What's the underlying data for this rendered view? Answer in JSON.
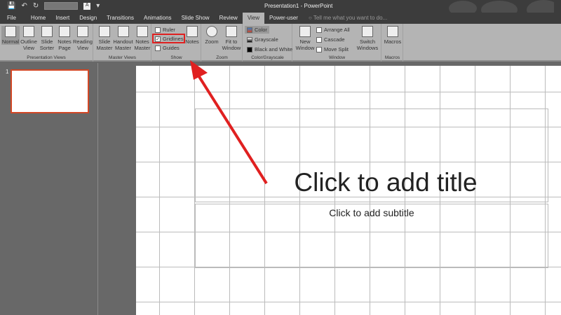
{
  "window": {
    "title": "Presentation1 - PowerPoint"
  },
  "tabs": [
    "File",
    "Home",
    "Insert",
    "Design",
    "Transitions",
    "Animations",
    "Slide Show",
    "Review",
    "View",
    "Power-user"
  ],
  "tell_me": "Tell me what you want to do...",
  "ribbon": {
    "presentation_views": {
      "label": "Presentation Views",
      "buttons": [
        "Normal",
        "Outline View",
        "Slide Sorter",
        "Notes Page",
        "Reading View"
      ]
    },
    "master_views": {
      "label": "Master Views",
      "buttons": [
        "Slide Master",
        "Handout Master",
        "Notes Master"
      ]
    },
    "show": {
      "label": "Show",
      "ruler": "Ruler",
      "gridlines": "Gridlines",
      "guides": "Guides",
      "notes": "Notes",
      "ruler_checked": false,
      "gridlines_checked": true,
      "guides_checked": false
    },
    "zoom": {
      "label": "Zoom",
      "zoom": "Zoom",
      "fit": "Fit to Window"
    },
    "color": {
      "label": "Color/Grayscale",
      "color": "Color",
      "grayscale": "Grayscale",
      "bw": "Black and White"
    },
    "window": {
      "label": "Window",
      "new_window": "New Window",
      "arrange_all": "Arrange All",
      "cascade": "Cascade",
      "move_split": "Move Split",
      "switch": "Switch Windows"
    },
    "macros": {
      "label": "Macros",
      "macros": "Macros"
    }
  },
  "thumbnail": {
    "number": "1"
  },
  "slide": {
    "title_placeholder": "Click to add title",
    "subtitle_placeholder": "Click to add subtitle"
  },
  "colors": {
    "accent": "#d24726",
    "annotation": "#e02020"
  }
}
